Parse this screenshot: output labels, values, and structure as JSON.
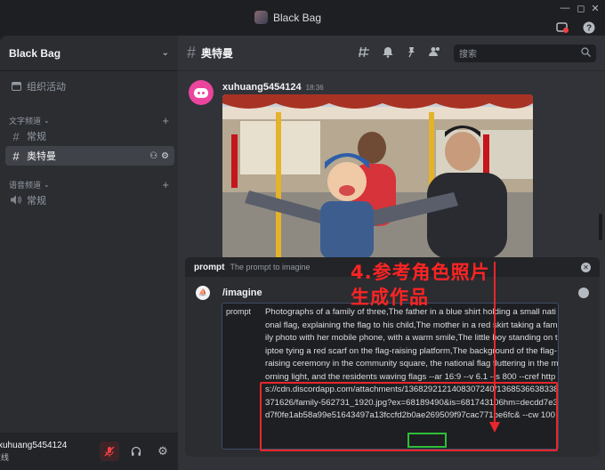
{
  "window": {
    "title": "Black Bag",
    "controls": [
      "—",
      "◻",
      "✕"
    ],
    "icons": [
      "inbox-icon",
      "help-icon"
    ]
  },
  "sidebar": {
    "server_name": "Black Bag",
    "event_label": "组织活动",
    "text_category": "文字频道",
    "text_channels": [
      {
        "label": "常规"
      },
      {
        "label": "奥特曼"
      }
    ],
    "voice_category": "语音频道",
    "voice_channels": [
      {
        "label": "常规"
      }
    ]
  },
  "user": {
    "name": "xuhuang5454124",
    "status": "在线"
  },
  "channel": {
    "name": "奥特曼",
    "search_placeholder": "搜索"
  },
  "message": {
    "author": "xuhuang5454124",
    "time": "18:36"
  },
  "command": {
    "param_name": "prompt",
    "param_desc": "The prompt to imagine",
    "name": "/imagine",
    "field_label": "prompt",
    "prompt_text": "Photographs of a family of three,The father in a blue shirt holding a small national flag, explaining the flag to his child,The mother in a red skirt taking a family photo with her mobile phone, with a warm smile,The little boy standing on tiptoe tying a red scarf on the flag-raising platform,The background of the flag-raising ceremony in the community square, the national flag fluttering in the morning light, and the residents waving flags --ar 16:9 --v 6.1 --s 800 --cref https://cdn.discordapp.com/attachments/1368292121408307240/1368536638338371626/family-562731_1920.jpg?ex=68189490&is=681743106hm=decdd7e3d7f0fe1ab58a99e51643497a13fccfd2b0ae269509f97cac771be6fc& --cw 100"
  },
  "annotation": {
    "line1": "4.参考角色照片",
    "line2": "生成作品"
  },
  "colors": {
    "annotation_red": "#ff2424",
    "highlight_red": "#e8262b",
    "highlight_green": "#2fbf3a",
    "avatar_pink": "#eb459e"
  }
}
